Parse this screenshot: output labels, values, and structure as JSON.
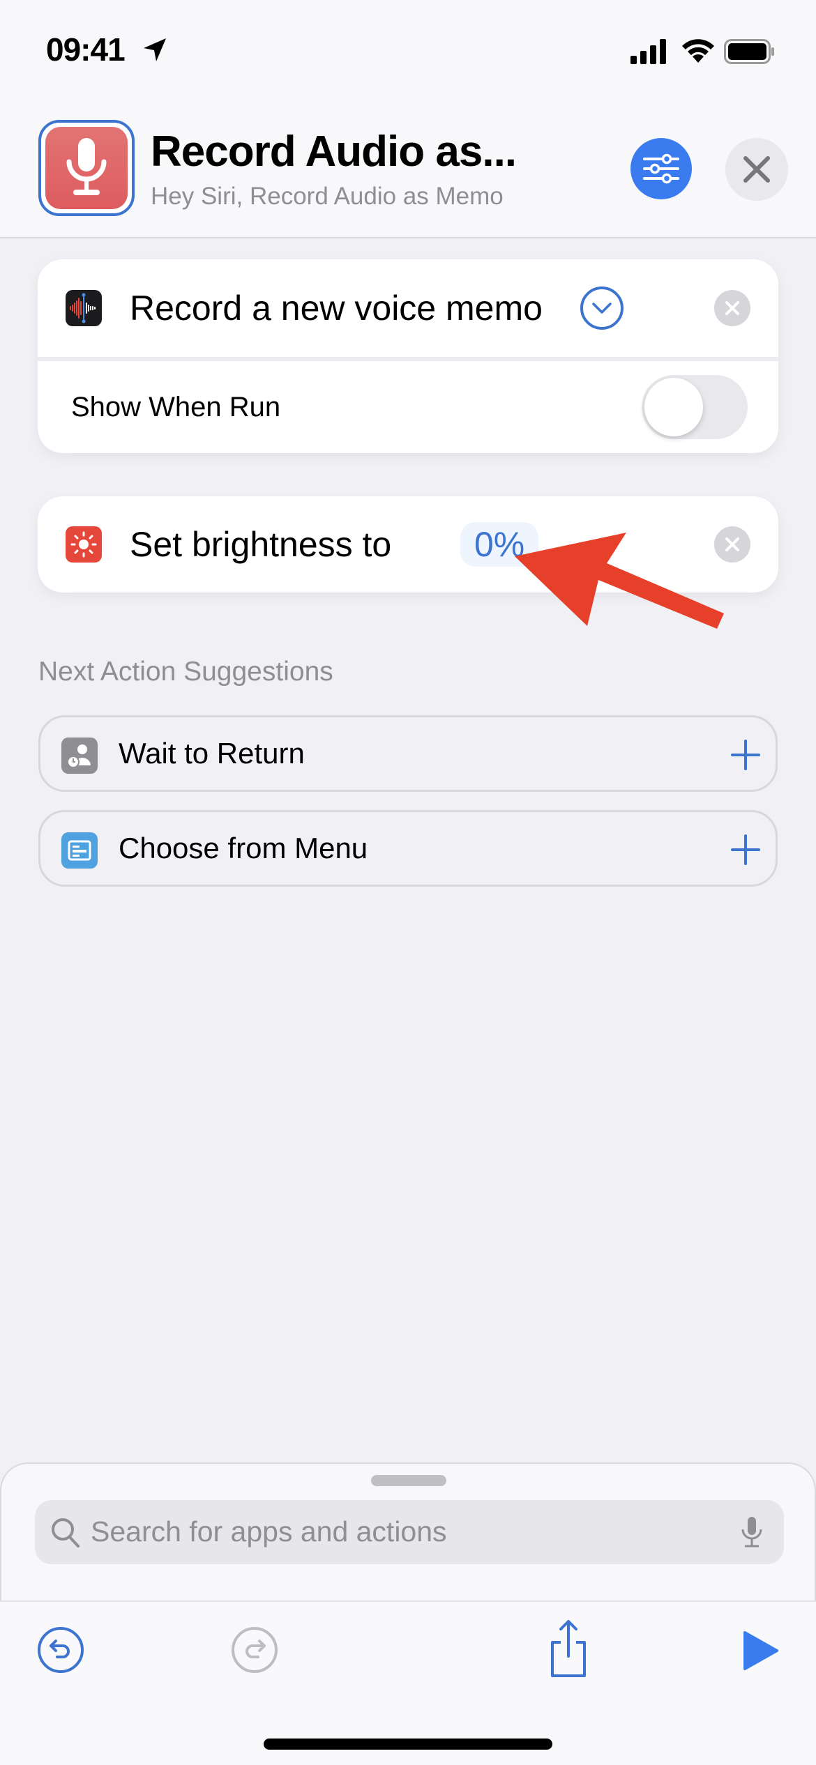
{
  "status_bar": {
    "time": "09:41",
    "icons": [
      "location-arrow-icon",
      "cellular-signal-icon",
      "wifi-icon",
      "battery-icon"
    ]
  },
  "header": {
    "title": "Record Audio as...",
    "subtitle": "Hey Siri, Record Audio as Memo",
    "app_icon": "microphone-icon",
    "app_icon_color": "#de5c5f",
    "settings_icon": "sliders-icon",
    "close_icon": "close-icon",
    "accent": "#3a7cf0"
  },
  "actions": [
    {
      "label": "Record a new voice memo",
      "icon": "voice-memos-icon",
      "expand_icon": "chevron-down-icon",
      "option": {
        "label": "Show When Run",
        "value": false
      }
    },
    {
      "label": "Set brightness to",
      "icon": "brightness-icon",
      "icon_color": "#e5483b",
      "parameter": "0%"
    }
  ],
  "annotation": {
    "icon": "red-arrow-icon",
    "color": "#e6402a"
  },
  "suggestions": {
    "heading": "Next Action Suggestions",
    "items": [
      {
        "label": "Wait to Return",
        "icon": "wait-to-return-icon",
        "icon_color": "#8e8e93"
      },
      {
        "label": "Choose from Menu",
        "icon": "menu-icon",
        "icon_color": "#4fa2e0"
      }
    ]
  },
  "search": {
    "placeholder": "Search for apps and actions"
  },
  "toolbar": {
    "undo": "undo-icon",
    "redo": "redo-icon",
    "share": "share-icon",
    "run": "play-icon"
  }
}
